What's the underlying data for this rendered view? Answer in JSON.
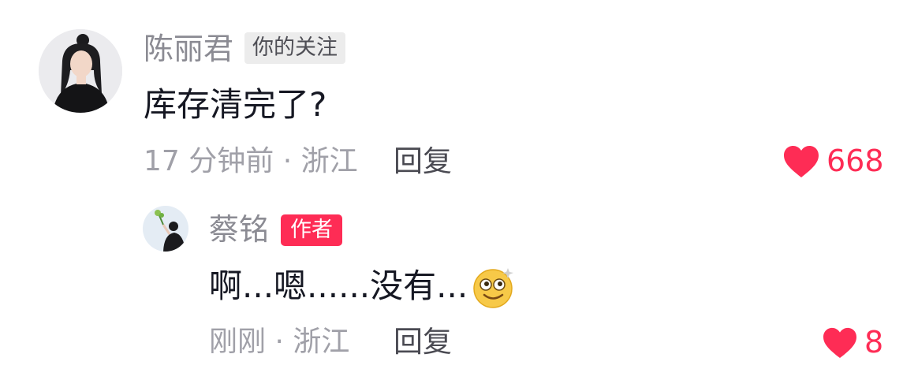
{
  "comment": {
    "author": "陈丽君",
    "tag": "你的关注",
    "text": "库存清完了?",
    "meta": "17 分钟前 · 浙江",
    "reply_label": "回复",
    "likes": "668"
  },
  "reply": {
    "author": "蔡铭",
    "tag": "作者",
    "text": "啊...嗯......没有...",
    "emoji": "dizzy-smile-emoji",
    "meta": "刚刚 · 浙江",
    "reply_label": "回复",
    "likes": "8"
  },
  "colors": {
    "accent": "#fe2c55",
    "name": "#8b8b93",
    "meta": "#a0a0a8",
    "text": "#161823"
  }
}
